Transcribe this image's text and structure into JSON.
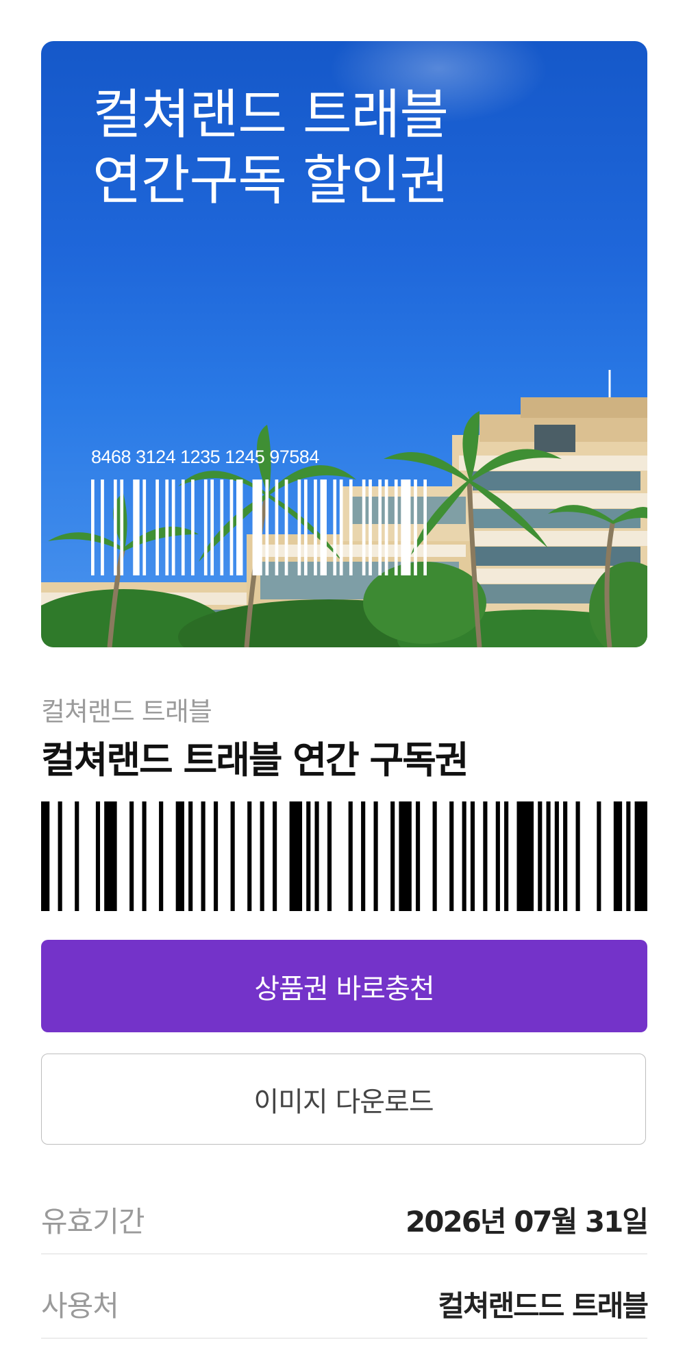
{
  "hero": {
    "title_line1": "컬쳐랜드 트래블",
    "title_line2": "연간구독 할인권",
    "code_number": "8468 3124 1235 1245 97584"
  },
  "voucher": {
    "brand": "컬쳐랜드 트래블",
    "product_name": "컬쳐랜드 트래블 연간 구독권"
  },
  "actions": {
    "charge_label": "상품권 바로충천",
    "download_label": "이미지 다운로드"
  },
  "details": {
    "expiry_label": "유효기간",
    "expiry_value": "2026년 07월 31일",
    "place_label": "사용처",
    "place_value": "컬쳐랜드드 트래블"
  },
  "colors": {
    "primary": "#7433c9",
    "sky": "#1f67da",
    "label_gray": "#9a9a9a"
  },
  "icons": {
    "hero_image": "resort-palm-tree-photo"
  }
}
